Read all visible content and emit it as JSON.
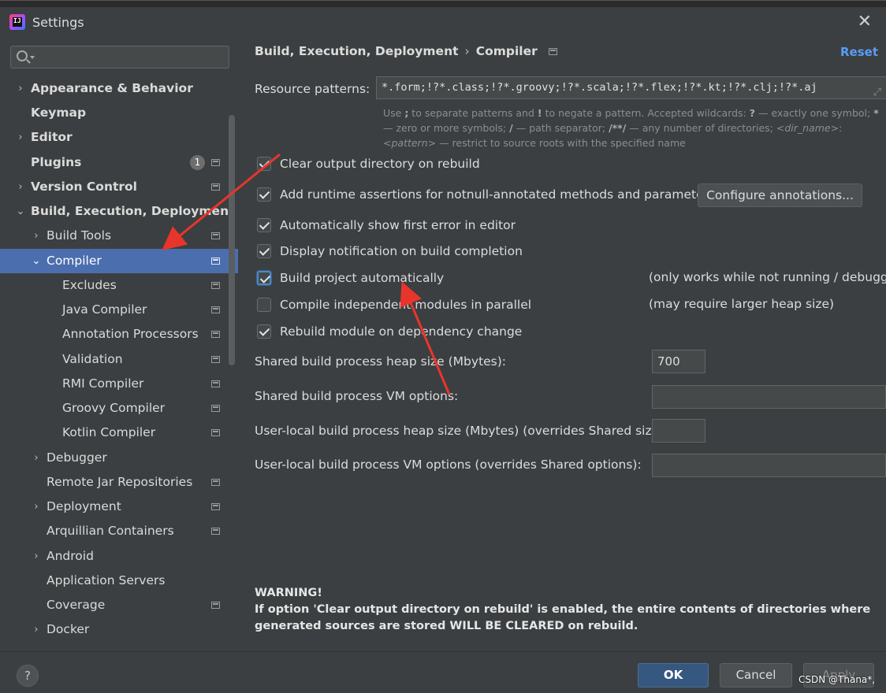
{
  "window": {
    "title": "Settings"
  },
  "search": {
    "placeholder": ""
  },
  "sidebar": {
    "items": [
      {
        "label": "Appearance & Behavior",
        "chevron": "›",
        "badge": ""
      },
      {
        "label": "Keymap",
        "chevron": "",
        "badge": ""
      },
      {
        "label": "Editor",
        "chevron": "›",
        "badge": ""
      },
      {
        "label": "Plugins",
        "chevron": "",
        "badge": "1"
      },
      {
        "label": "Version Control",
        "chevron": "›",
        "badge": ""
      },
      {
        "label": "Build, Execution, Deployment",
        "chevron": "⌄",
        "badge": ""
      },
      {
        "label": "Build Tools",
        "chevron": "›",
        "badge": ""
      },
      {
        "label": "Compiler",
        "chevron": "⌄",
        "badge": ""
      },
      {
        "label": "Excludes",
        "chevron": "",
        "badge": ""
      },
      {
        "label": "Java Compiler",
        "chevron": "",
        "badge": ""
      },
      {
        "label": "Annotation Processors",
        "chevron": "",
        "badge": ""
      },
      {
        "label": "Validation",
        "chevron": "",
        "badge": ""
      },
      {
        "label": "RMI Compiler",
        "chevron": "",
        "badge": ""
      },
      {
        "label": "Groovy Compiler",
        "chevron": "",
        "badge": ""
      },
      {
        "label": "Kotlin Compiler",
        "chevron": "",
        "badge": ""
      },
      {
        "label": "Debugger",
        "chevron": "›",
        "badge": ""
      },
      {
        "label": "Remote Jar Repositories",
        "chevron": "",
        "badge": ""
      },
      {
        "label": "Deployment",
        "chevron": "›",
        "badge": ""
      },
      {
        "label": "Arquillian Containers",
        "chevron": "",
        "badge": ""
      },
      {
        "label": "Android",
        "chevron": "›",
        "badge": ""
      },
      {
        "label": "Application Servers",
        "chevron": "",
        "badge": ""
      },
      {
        "label": "Coverage",
        "chevron": "",
        "badge": ""
      },
      {
        "label": "Docker",
        "chevron": "›",
        "badge": ""
      }
    ]
  },
  "main": {
    "breadcrumb": {
      "parent": "Build, Execution, Deployment",
      "separator": "›",
      "current": "Compiler"
    },
    "reset_label": "Reset",
    "resource_patterns": {
      "label": "Resource patterns:",
      "value": "*.form;!?*.class;!?*.groovy;!?*.scala;!?*.flex;!?*.kt;!?*.clj;!?*.aj"
    },
    "hint": {
      "p1": "Use ",
      "semi": ";",
      "p2": " to separate patterns and ",
      "bang": "!",
      "p3": " to negate a pattern. Accepted wildcards: ",
      "q": "?",
      "p4": " — exactly one symbol; ",
      "star": "*",
      "p5": " — zero or more symbols; ",
      "slash": "/",
      "p6": " — path separator; ",
      "dstar": "/**/",
      "p7": " — any number of directories; ",
      "dir": "<dir_name>",
      "colon": ":",
      "pat": "<pattern>",
      "p8": " — restrict to source roots with the specified name"
    },
    "options": [
      {
        "label": "Clear output directory on rebuild",
        "checked": true,
        "note": ""
      },
      {
        "label": "Add runtime assertions for notnull-annotated methods and parameters",
        "checked": true,
        "note": ""
      },
      {
        "label": "Automatically show first error in editor",
        "checked": true,
        "note": ""
      },
      {
        "label": "Display notification on build completion",
        "checked": true,
        "note": ""
      },
      {
        "label": "Build project automatically",
        "checked": true,
        "note": "(only works while not running / debugging)"
      },
      {
        "label": "Compile independent modules in parallel",
        "checked": false,
        "note": "(may require larger heap size)"
      },
      {
        "label": "Rebuild module on dependency change",
        "checked": true,
        "note": ""
      }
    ],
    "configure_annotations_label": "Configure annotations...",
    "fields": {
      "shared_heap": {
        "label": "Shared build process heap size (Mbytes):",
        "value": "700"
      },
      "shared_vm": {
        "label": "Shared build process VM options:",
        "value": ""
      },
      "user_heap": {
        "label": "User-local build process heap size (Mbytes) (overrides Shared size):",
        "value": ""
      },
      "user_vm": {
        "label": "User-local build process VM options (overrides Shared options):",
        "value": ""
      }
    },
    "warning": {
      "title": "WARNING!",
      "text": "If option 'Clear output directory on rebuild' is enabled, the entire contents of directories where generated sources are stored WILL BE CLEARED on rebuild."
    }
  },
  "footer": {
    "help_label": "?",
    "ok_label": "OK",
    "cancel_label": "Cancel",
    "apply_label": "Apply",
    "watermark": "CSDN @Thana*,"
  },
  "colors": {
    "selection": "#4b6eaf",
    "link": "#589df6",
    "annotation_arrow": "#e8352b"
  }
}
